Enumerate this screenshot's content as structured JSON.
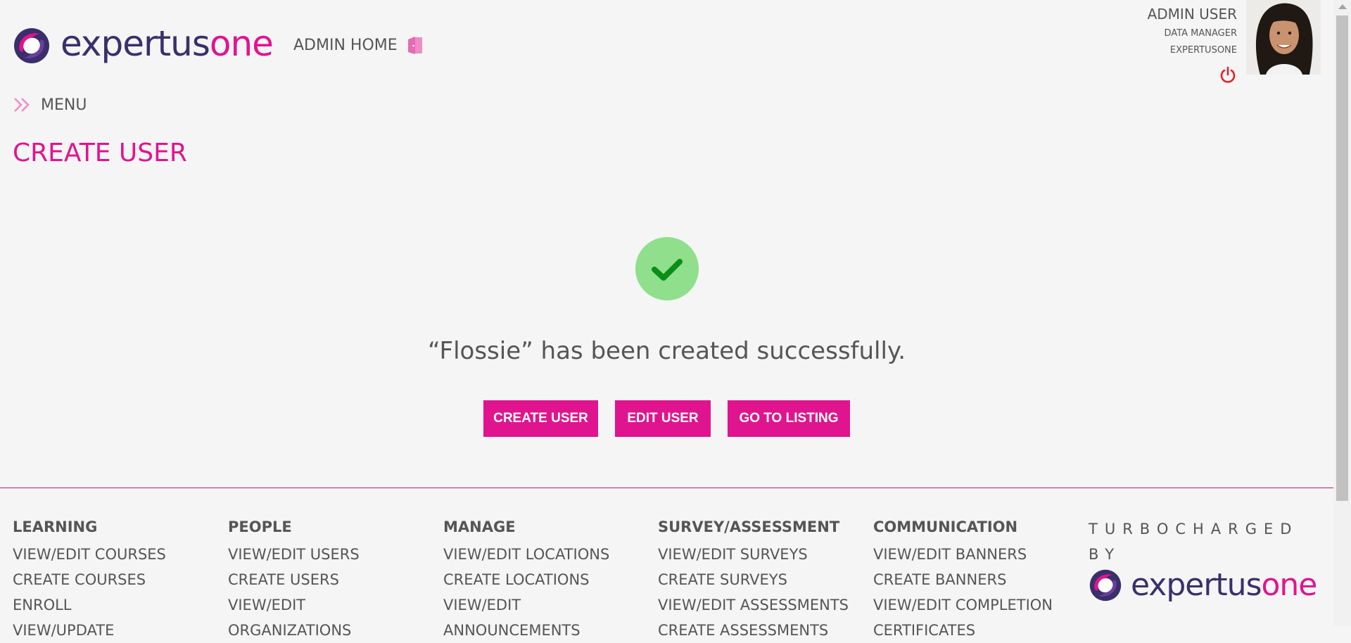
{
  "brand": {
    "name_prefix": "expertus",
    "name_suffix": "one",
    "primary_color": "#e0148f",
    "secondary_color": "#3a2f6b"
  },
  "header": {
    "admin_home_label": "ADMIN HOME",
    "door_icon": "door-icon",
    "user": {
      "name": "ADMIN USER",
      "role": "DATA MANAGER",
      "organization": "EXPERTUSONE"
    },
    "power_icon": "power-icon"
  },
  "menu": {
    "label": "MENU",
    "icon": "double-chevron-right-icon"
  },
  "page": {
    "title": "CREATE USER"
  },
  "success": {
    "icon": "check-icon",
    "message": "“Flossie” has been created successfully.",
    "buttons": {
      "create_user": "CREATE USER",
      "edit_user": "EDIT USER",
      "go_to_listing": "GO TO LISTING"
    }
  },
  "footer": {
    "columns": [
      {
        "heading": "LEARNING",
        "links": [
          "VIEW/EDIT COURSES",
          "CREATE COURSES",
          "ENROLL",
          "VIEW/UPDATE"
        ]
      },
      {
        "heading": "PEOPLE",
        "links": [
          "VIEW/EDIT USERS",
          "CREATE USERS",
          "VIEW/EDIT",
          "ORGANIZATIONS"
        ]
      },
      {
        "heading": "MANAGE",
        "links": [
          "VIEW/EDIT LOCATIONS",
          "CREATE LOCATIONS",
          "VIEW/EDIT",
          "ANNOUNCEMENTS"
        ]
      },
      {
        "heading": "SURVEY/ASSESSMENT",
        "links": [
          "VIEW/EDIT SURVEYS",
          "CREATE SURVEYS",
          "VIEW/EDIT ASSESSMENTS",
          "CREATE ASSESSMENTS"
        ]
      },
      {
        "heading": "COMMUNICATION",
        "links": [
          "VIEW/EDIT BANNERS",
          "CREATE BANNERS",
          "VIEW/EDIT COMPLETION",
          "CERTIFICATES"
        ]
      }
    ],
    "turbocharged_label": "TURBOCHARGED BY"
  }
}
